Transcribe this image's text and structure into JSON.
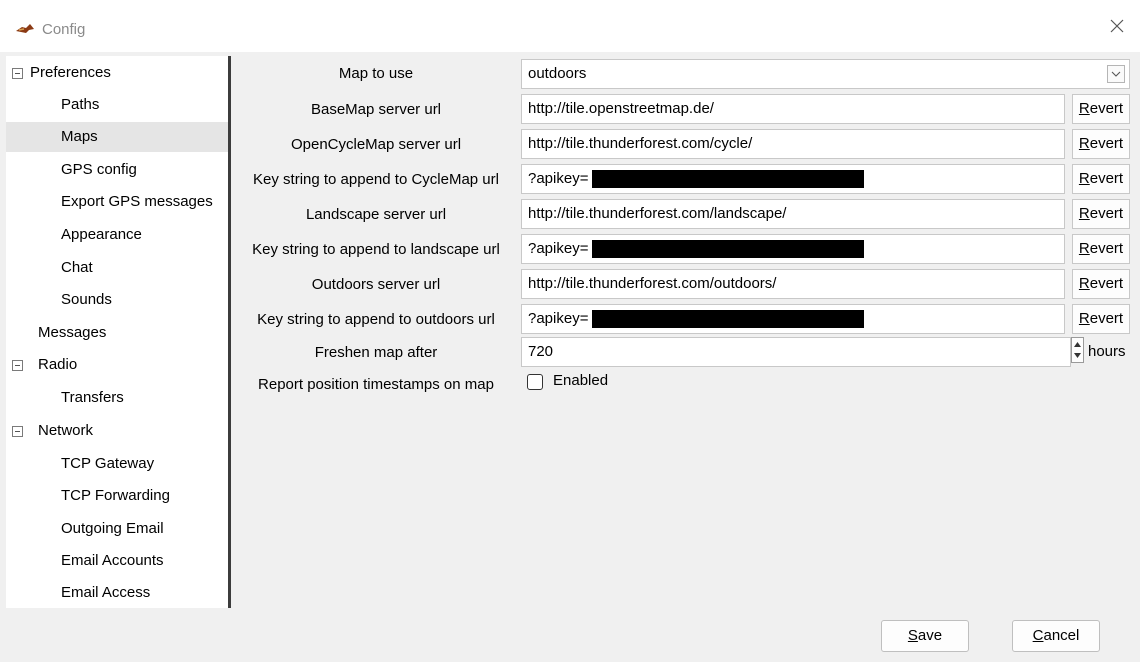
{
  "window": {
    "title": "Config",
    "icon": "app-logo-icon",
    "close_icon": "close-icon"
  },
  "tree": {
    "items": [
      {
        "label": "Preferences",
        "level": 0,
        "expander": true,
        "selected": false
      },
      {
        "label": "Paths",
        "level": 1,
        "expander": false,
        "selected": false
      },
      {
        "label": "Maps",
        "level": 1,
        "expander": false,
        "selected": true
      },
      {
        "label": "GPS config",
        "level": 1,
        "expander": false,
        "selected": false
      },
      {
        "label": "Export GPS messages",
        "level": 1,
        "expander": false,
        "selected": false
      },
      {
        "label": "Appearance",
        "level": 1,
        "expander": false,
        "selected": false
      },
      {
        "label": "Chat",
        "level": 1,
        "expander": false,
        "selected": false
      },
      {
        "label": "Sounds",
        "level": 1,
        "expander": false,
        "selected": false
      },
      {
        "label": "Messages",
        "level": 0,
        "expander": false,
        "selected": false
      },
      {
        "label": "Radio",
        "level": 0,
        "expander": true,
        "selected": false
      },
      {
        "label": "Transfers",
        "level": 1,
        "expander": false,
        "selected": false
      },
      {
        "label": "Network",
        "level": 0,
        "expander": true,
        "selected": false
      },
      {
        "label": "TCP Gateway",
        "level": 1,
        "expander": false,
        "selected": false
      },
      {
        "label": "TCP Forwarding",
        "level": 1,
        "expander": false,
        "selected": false
      },
      {
        "label": "Outgoing Email",
        "level": 1,
        "expander": false,
        "selected": false
      },
      {
        "label": "Email Accounts",
        "level": 1,
        "expander": false,
        "selected": false
      },
      {
        "label": "Email Access",
        "level": 1,
        "expander": false,
        "selected": false
      }
    ]
  },
  "maps": {
    "map_to_use": {
      "label": "Map to use",
      "value": "outdoors"
    },
    "basemap_url": {
      "label": "BaseMap server url",
      "value": "http://tile.openstreetmap.de/"
    },
    "opencyclemap_url": {
      "label": "OpenCycleMap server url",
      "value": "http://tile.thunderforest.com/cycle/"
    },
    "cyclemap_key": {
      "label": "Key string to append to CycleMap url",
      "value": "?apikey="
    },
    "landscape_url": {
      "label": "Landscape server url",
      "value": "http://tile.thunderforest.com/landscape/"
    },
    "landscape_key": {
      "label": "Key string to append to landscape url",
      "value": "?apikey="
    },
    "outdoors_url": {
      "label": "Outdoors server url",
      "value": "http://tile.thunderforest.com/outdoors/"
    },
    "outdoors_key": {
      "label": "Key string to append to outdoors url",
      "value": "?apikey="
    },
    "freshen": {
      "label": "Freshen map after",
      "value": "720",
      "unit": "hours"
    },
    "timestamps": {
      "label": "Report position timestamps on map",
      "checkbox_label": "Enabled",
      "checked": false
    },
    "revert_label": "Revert"
  },
  "footer": {
    "save_label": "Save",
    "cancel_label": "Cancel"
  },
  "colors": {
    "selected_row": "#e5e5e5",
    "redaction": "#000000"
  }
}
